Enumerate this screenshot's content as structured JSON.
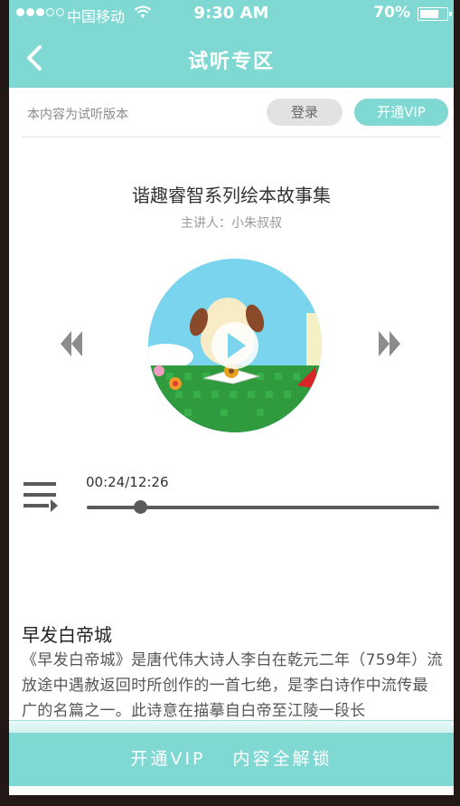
{
  "status_bar": {
    "carrier": "中国移动",
    "time": "9:30 AM",
    "battery": "70%",
    "battery_level": 0.7
  },
  "nav": {
    "title": "试听专区",
    "back_icon": "chevron-left-icon"
  },
  "notice": {
    "text": "本内容为试听版本",
    "login_label": "登录",
    "vip_label": "开通VIP"
  },
  "book": {
    "title": "谐趣睿智系列绘本故事集",
    "speaker": "主讲人：小朱叔叔"
  },
  "player": {
    "time_display": "00:24/12:26",
    "current_seconds": 24,
    "total_seconds": 746,
    "prev_icon": "rewind-icon",
    "next_icon": "fast-forward-icon",
    "play_icon": "play-icon",
    "playlist_icon": "playlist-icon"
  },
  "article": {
    "title": "早发白帝城",
    "body": "《早发白帝城》是唐代伟大诗人李白在乾元二年（759年）流放途中遇赦返回时所创作的一首七绝，是李白诗作中流传最广的名篇之一。此诗意在描摹自白帝至江陵一段长"
  },
  "cta": {
    "left": "开通VIP",
    "right": "内容全解锁"
  },
  "colors": {
    "accent": "#7fd8d2",
    "track": "#5a5a5a"
  }
}
